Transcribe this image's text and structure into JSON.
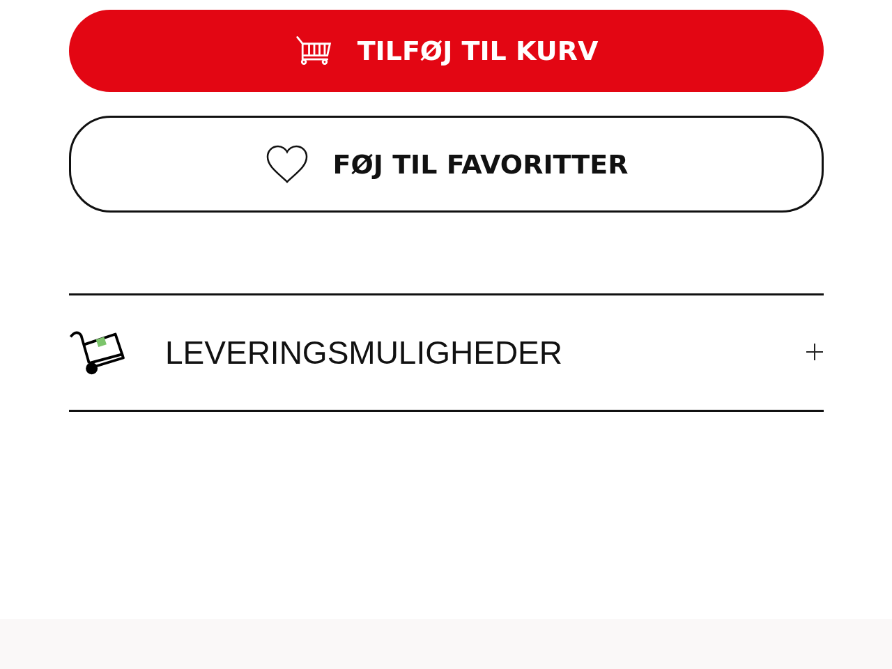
{
  "buttons": [
    {
      "kind": "primary",
      "label": "TILFØJ TIL KURV"
    },
    {
      "kind": "secondary",
      "label": "FØJ TIL FAVORITTER"
    }
  ],
  "accordion": [
    {
      "title": "LEVERINGSMULIGHEDER",
      "expanded": false
    }
  ]
}
